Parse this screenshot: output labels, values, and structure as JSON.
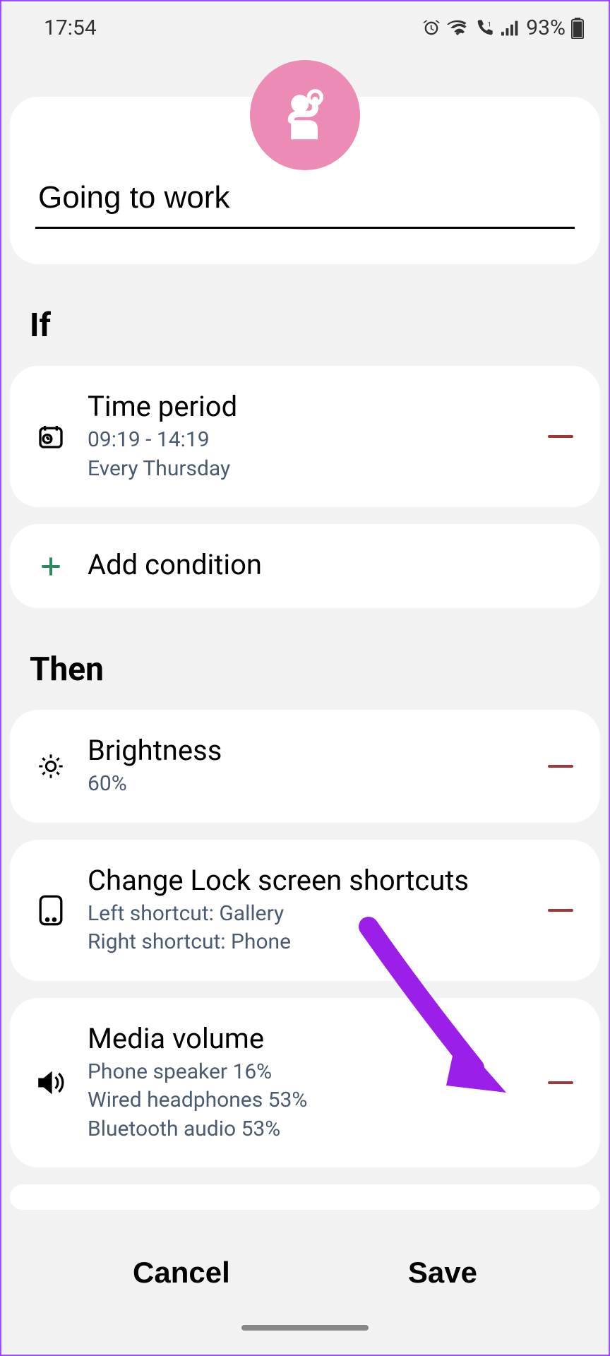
{
  "status": {
    "time": "17:54",
    "battery": "93%"
  },
  "routine": {
    "name": "Going to work"
  },
  "sections": {
    "if_label": "If",
    "then_label": "Then"
  },
  "conditions": [
    {
      "title": "Time period",
      "time_range": "09:19 - 14:19",
      "repeat": "Every Thursday"
    }
  ],
  "add_condition_label": "Add condition",
  "actions": [
    {
      "title": "Brightness",
      "value": "60%"
    },
    {
      "title": "Change Lock screen shortcuts",
      "left": "Left shortcut: Gallery",
      "right": "Right shortcut: Phone"
    },
    {
      "title": "Media volume",
      "speaker": "Phone speaker 16%",
      "wired": "Wired headphones 53%",
      "bluetooth": "Bluetooth audio 53%"
    }
  ],
  "buttons": {
    "cancel": "Cancel",
    "save": "Save"
  }
}
